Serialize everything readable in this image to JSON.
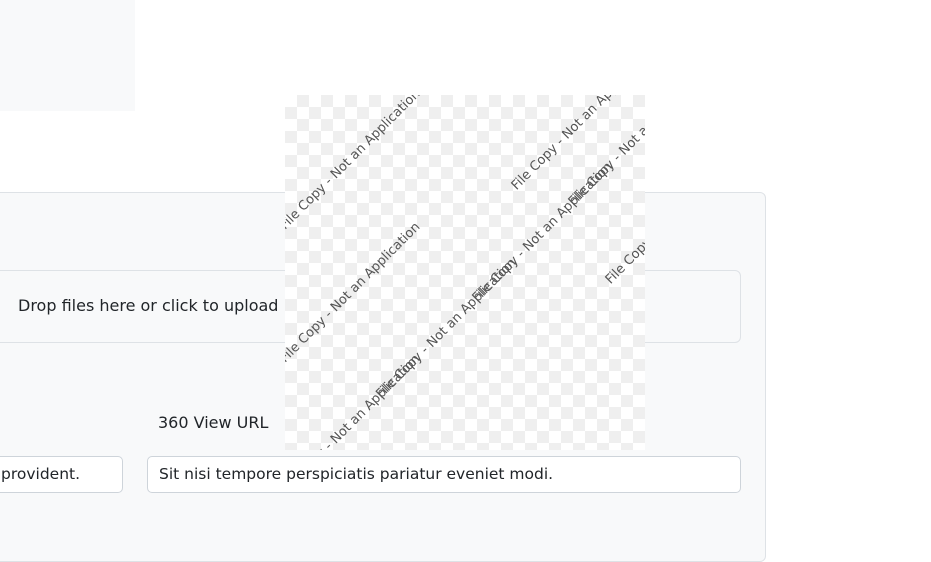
{
  "dropzone": {
    "text": "Drop files here or click to upload"
  },
  "form": {
    "left_input_value": "provident.",
    "view360": {
      "label": "360 View URL",
      "value": "Sit nisi tempore perspiciatis pariatur eveniet modi."
    }
  },
  "preview": {
    "watermark": "File Copy - Not an Application"
  },
  "colors": {
    "panel": "#f8f9fa",
    "border": "#dee2e6",
    "input_border": "#ced4da",
    "watermark_text": "#555555"
  }
}
